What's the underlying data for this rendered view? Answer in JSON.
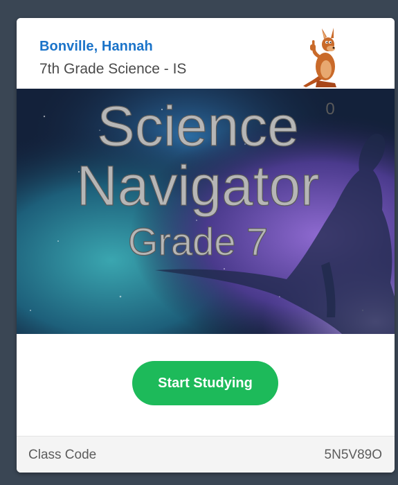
{
  "card": {
    "student_name": "Bonville, Hannah",
    "class_name": "7th Grade Science - IS",
    "score": "0",
    "mascot_icon": "kangaroo-mascot-icon",
    "banner": {
      "line1": "Science",
      "line2": "Navigator",
      "line3": "Grade 7"
    },
    "start_button_label": "Start Studying",
    "class_code_label": "Class Code",
    "class_code_value": "5N5V89O"
  },
  "colors": {
    "name": "#1a73c9",
    "button": "#1dba5a",
    "background": "#3a4654"
  }
}
